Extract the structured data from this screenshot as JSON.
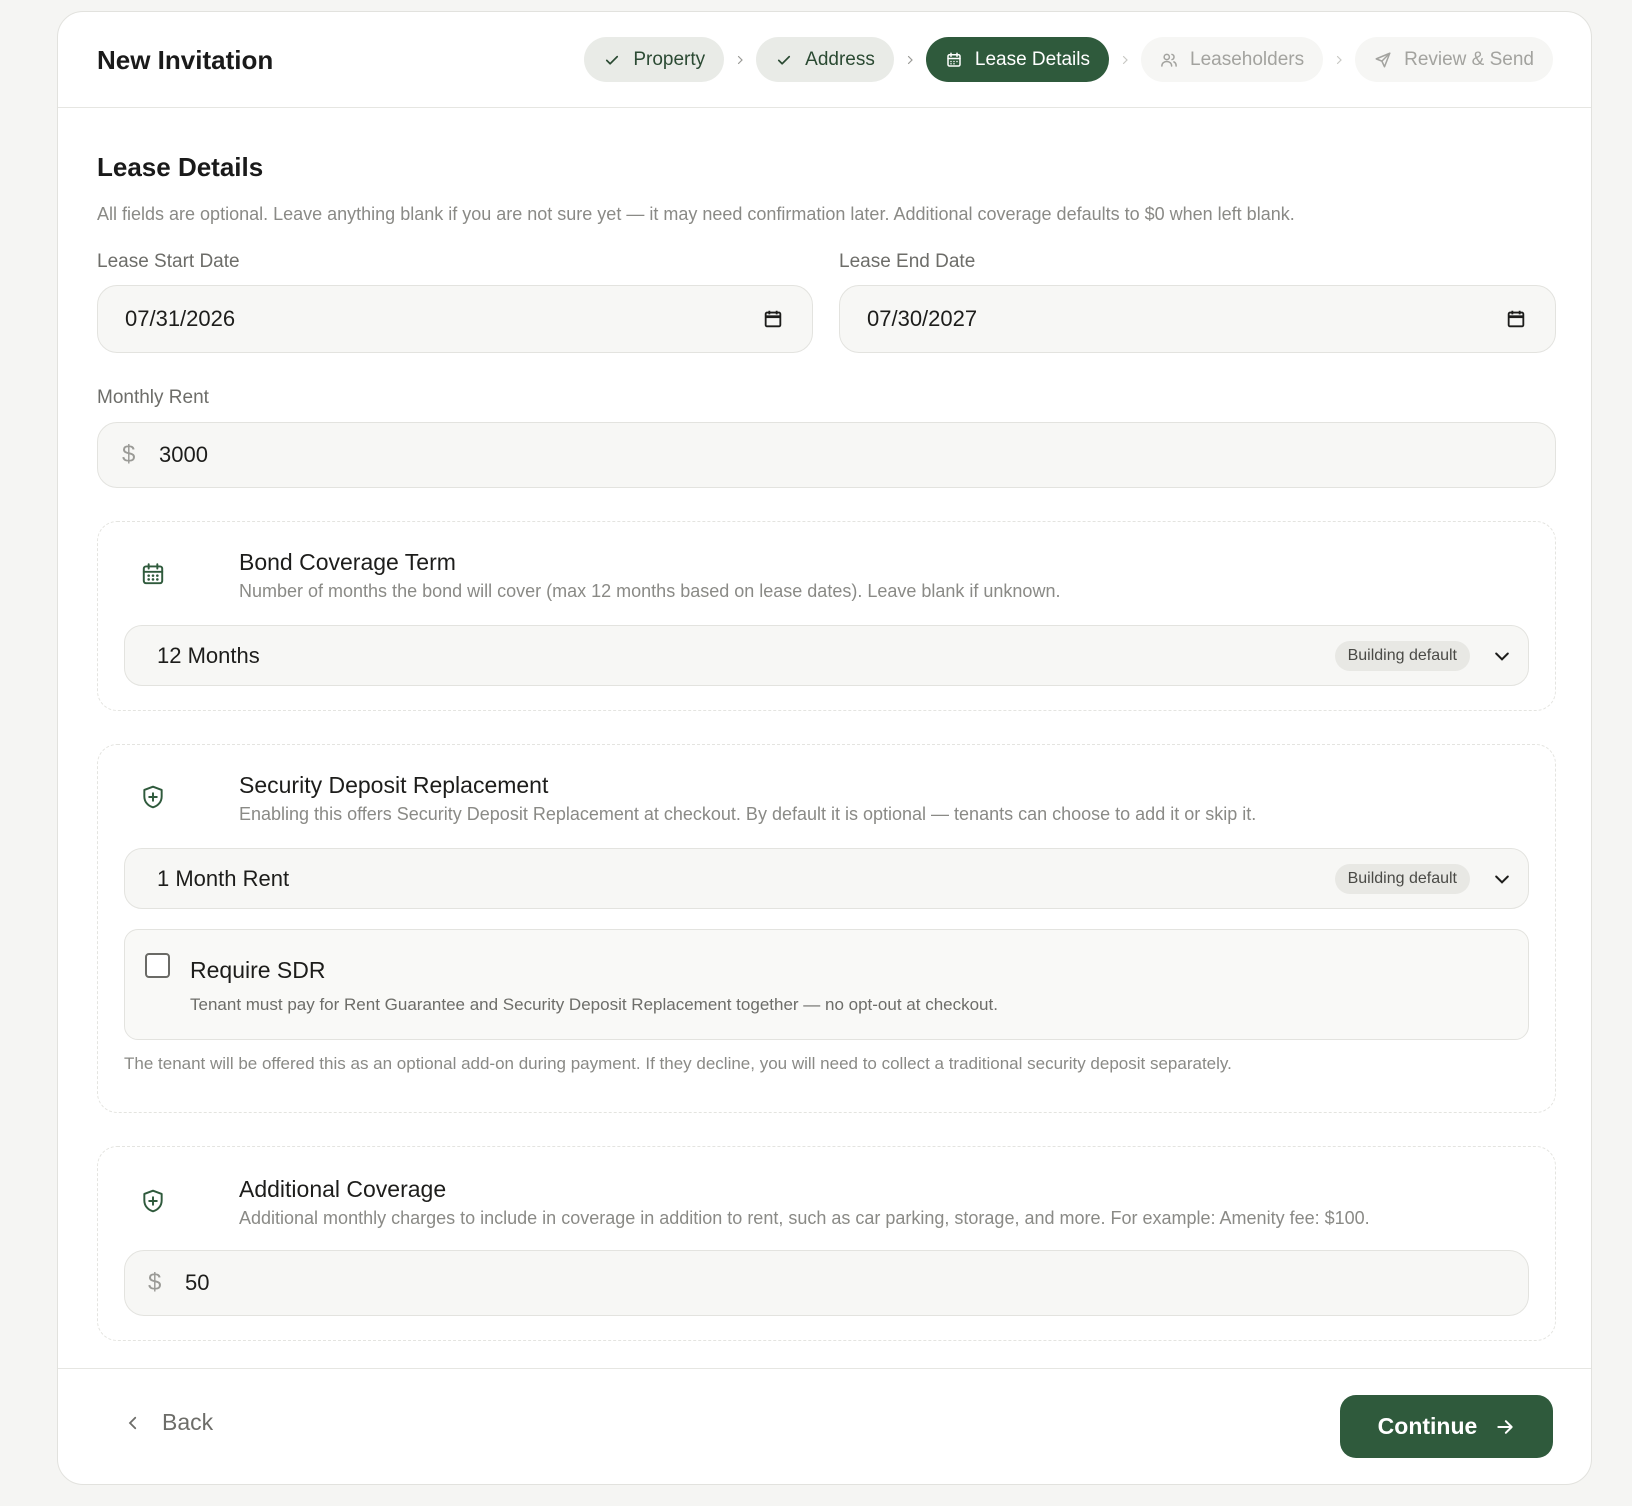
{
  "header": {
    "title": "New Invitation",
    "steps": [
      {
        "label": "Property",
        "state": "done",
        "icon": "check-icon"
      },
      {
        "label": "Address",
        "state": "done",
        "icon": "check-icon"
      },
      {
        "label": "Lease Details",
        "state": "active",
        "icon": "calendar-icon"
      },
      {
        "label": "Leaseholders",
        "state": "pending",
        "icon": "users-icon"
      },
      {
        "label": "Review & Send",
        "state": "pending",
        "icon": "send-icon"
      }
    ]
  },
  "section": {
    "title": "Lease Details",
    "description": "All fields are optional. Leave anything blank if you are not sure yet — it may need confirmation later. Additional coverage defaults to $0 when left blank."
  },
  "lease_start": {
    "label": "Lease Start Date",
    "value": "07/31/2026"
  },
  "lease_end": {
    "label": "Lease End Date",
    "value": "07/30/2027"
  },
  "monthly_rent": {
    "label": "Monthly Rent",
    "currency": "$",
    "value": "3000"
  },
  "bond_term": {
    "title": "Bond Coverage Term",
    "description": "Number of months the bond will cover (max 12 months based on lease dates). Leave blank if unknown.",
    "selected": "12 Months",
    "badge": "Building default"
  },
  "sdr": {
    "title": "Security Deposit Replacement",
    "description": "Enabling this offers Security Deposit Replacement at checkout. By default it is optional — tenants can choose to add it or skip it.",
    "selected": "1 Month Rent",
    "badge": "Building default",
    "require_title": "Require SDR",
    "require_desc": "Tenant must pay for Rent Guarantee and Security Deposit Replacement together — no opt-out at checkout.",
    "require_checked": false,
    "note": "The tenant will be offered this as an optional add-on during payment. If they decline, you will need to collect a traditional security deposit separately."
  },
  "additional": {
    "title": "Additional Coverage",
    "description": "Additional monthly charges to include in coverage in addition to rent, such as car parking, storage, and more. For example: Amenity fee: $100.",
    "currency": "$",
    "value": "50"
  },
  "footer": {
    "back_label": "Back",
    "continue_label": "Continue"
  },
  "colors": {
    "primary": "#2f5a3c",
    "muted_text": "#8a8a86",
    "field_bg": "#f7f7f5"
  }
}
